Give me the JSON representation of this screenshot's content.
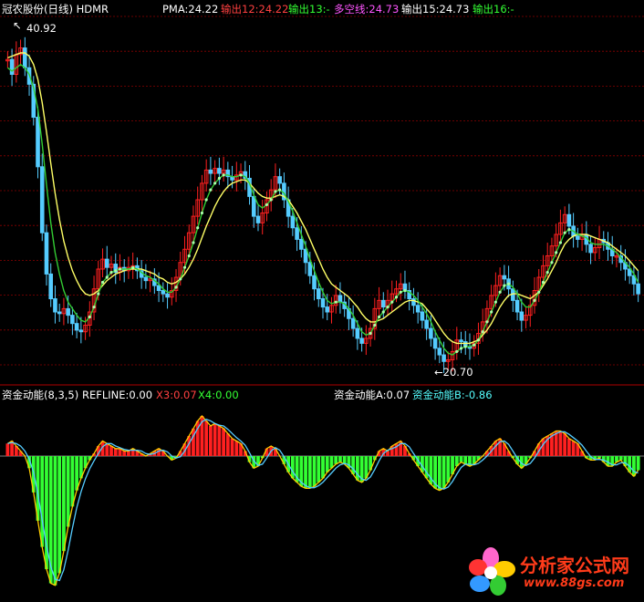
{
  "header": {
    "title": "冠农股份(日线) HDMR",
    "pma": "PMA:24.22",
    "out12": "输出12:24.22",
    "out13": "输出13:-",
    "multi": "多空线:24.73",
    "out15": "输出15:24.73",
    "out16": "输出16:-"
  },
  "indicator": {
    "title": "资金动能(8,3,5)",
    "refline": "REFLINE:0.00",
    "x3": "X3:0.07",
    "x4": "X4:0.00",
    "a": "资金动能A:0.07",
    "b": "资金动能B:-0.86"
  },
  "annotations": {
    "high": "40.92",
    "low": "←20.70",
    "high_arrow": "↖"
  },
  "watermark": {
    "text": "分析家公式网",
    "url": "www.88gs.com"
  },
  "colors": {
    "background": "#000000",
    "grid": "#8b0000",
    "up_candle": "#ff2020",
    "down_candle": "#55ccff",
    "yellow_line": "#ffff66",
    "green_line": "#33cc33",
    "dot_line": "#aaffaa",
    "hist_pos": "#ff2020",
    "hist_neg": "#33ff33",
    "ind_a": "#ffcc00",
    "ind_b": "#55ccff",
    "text_white": "#ffffff",
    "text_red": "#ff4040",
    "text_green": "#33ff33",
    "text_magenta": "#ff55ff",
    "text_cyan": "#55ffff"
  },
  "chart_data": [
    {
      "type": "candlestick",
      "title": "冠农股份(日线) HDMR",
      "ylim": [
        20.0,
        42.0
      ],
      "annotations": [
        {
          "label": "40.92",
          "kind": "high"
        },
        {
          "label": "20.70",
          "kind": "low"
        }
      ],
      "close": [
        39.5,
        38.6,
        39.8,
        40.2,
        39.0,
        38.0,
        36.0,
        33.0,
        29.0,
        26.5,
        25.0,
        24.2,
        24.1,
        24.4,
        24.0,
        23.5,
        23.1,
        23.0,
        23.4,
        24.2,
        25.6,
        26.8,
        27.4,
        26.9,
        27.1,
        26.6,
        26.9,
        26.7,
        26.9,
        27.0,
        26.7,
        26.3,
        26.1,
        26.2,
        25.8,
        25.5,
        25.3,
        25.1,
        25.5,
        26.3,
        27.2,
        28.0,
        29.0,
        30.0,
        31.0,
        32.0,
        32.8,
        32.6,
        32.9,
        32.6,
        32.8,
        32.4,
        32.2,
        32.5,
        32.7,
        32.3,
        31.2,
        30.0,
        29.6,
        30.2,
        31.0,
        31.6,
        32.4,
        32.0,
        31.0,
        30.0,
        29.3,
        28.6,
        28.0,
        27.2,
        26.4,
        25.6,
        25.0,
        24.5,
        24.2,
        24.6,
        25.2,
        24.8,
        24.4,
        23.8,
        23.2,
        22.6,
        22.3,
        22.6,
        23.2,
        24.4,
        24.9,
        24.5,
        24.9,
        25.3,
        25.6,
        25.9,
        25.5,
        25.0,
        24.6,
        24.2,
        23.7,
        23.2,
        22.6,
        22.0,
        21.6,
        21.2,
        21.3,
        21.8,
        22.5,
        22.4,
        22.1,
        22.0,
        22.3,
        22.9,
        23.6,
        24.4,
        25.2,
        25.8,
        26.4,
        26.2,
        25.6,
        24.9,
        24.2,
        23.7,
        24.0,
        24.6,
        25.5,
        26.3,
        27.0,
        27.6,
        28.2,
        28.9,
        29.6,
        30.1,
        29.4,
        28.8,
        28.6,
        28.9,
        28.3,
        27.8,
        28.1,
        28.6,
        28.4,
        28.0,
        27.6,
        27.6,
        27.2,
        26.8,
        26.4,
        25.9,
        25.3
      ],
      "series": [
        {
          "name": "输出12",
          "values": [
            39.0,
            38.8,
            39.0,
            39.2,
            39.0,
            38.6,
            37.8,
            36.5,
            34.4,
            31.9,
            29.6,
            27.8,
            26.5,
            25.5,
            24.8,
            24.4,
            24.0,
            23.7,
            23.6,
            23.9,
            24.5,
            25.3,
            26.0,
            26.3,
            26.6,
            26.7,
            26.8,
            26.8,
            26.8,
            26.9,
            26.8,
            26.6,
            26.4,
            26.3,
            26.1,
            25.9,
            25.6,
            25.4,
            25.4,
            25.7,
            26.2,
            26.9,
            27.6,
            28.4,
            29.3,
            30.2,
            31.0,
            31.6,
            32.0,
            32.3,
            32.5,
            32.5,
            32.4,
            32.4,
            32.5,
            32.4,
            32.0,
            31.3,
            30.7,
            30.5,
            30.7,
            31.0,
            31.5,
            31.6,
            31.4,
            30.9,
            30.3,
            29.6,
            28.9,
            28.2,
            27.4,
            26.7,
            26.0,
            25.4,
            24.9,
            24.7,
            24.8,
            24.8,
            24.7,
            24.4,
            24.0,
            23.5,
            23.0,
            22.8,
            22.9,
            23.4,
            23.9,
            24.2,
            24.5,
            24.8,
            25.1,
            25.4,
            25.5,
            25.4,
            25.2,
            24.9,
            24.5,
            24.1,
            23.6,
            23.0,
            22.5,
            22.0,
            21.7,
            21.6,
            21.8,
            22.0,
            22.1,
            22.1,
            22.2,
            22.5,
            23.0,
            23.6,
            24.2,
            24.8,
            25.4,
            25.8,
            25.9,
            25.7,
            25.3,
            24.8,
            24.5,
            24.5,
            24.9,
            25.4,
            26.0,
            26.6,
            27.2,
            27.8,
            28.4,
            29.0,
            29.2,
            29.1,
            28.9,
            28.8,
            28.7,
            28.4,
            28.3,
            28.3,
            28.3,
            28.2,
            28.0,
            27.8,
            27.5,
            27.2,
            26.9,
            26.5,
            26.0
          ]
        },
        {
          "name": "多空线",
          "values": [
            39.6,
            39.7,
            39.8,
            39.9,
            39.9,
            39.7,
            39.2,
            38.3,
            36.9,
            35.1,
            33.2,
            31.4,
            29.8,
            28.5,
            27.5,
            26.7,
            26.1,
            25.6,
            25.3,
            25.2,
            25.3,
            25.5,
            25.8,
            26.1,
            26.3,
            26.5,
            26.6,
            26.7,
            26.8,
            26.8,
            26.8,
            26.8,
            26.7,
            26.6,
            26.5,
            26.3,
            26.2,
            26.0,
            25.9,
            26.0,
            26.2,
            26.5,
            26.9,
            27.4,
            28.0,
            28.7,
            29.4,
            30.0,
            30.6,
            31.1,
            31.5,
            31.8,
            32.0,
            32.1,
            32.2,
            32.2,
            32.0,
            31.7,
            31.4,
            31.2,
            31.1,
            31.1,
            31.2,
            31.3,
            31.2,
            31.0,
            30.6,
            30.2,
            29.7,
            29.2,
            28.6,
            28.0,
            27.4,
            26.8,
            26.3,
            25.9,
            25.7,
            25.5,
            25.3,
            25.1,
            24.8,
            24.5,
            24.1,
            23.8,
            23.6,
            23.6,
            23.7,
            23.8,
            24.0,
            24.2,
            24.4,
            24.6,
            24.8,
            24.9,
            24.9,
            24.8,
            24.7,
            24.4,
            24.1,
            23.7,
            23.3,
            22.9,
            22.6,
            22.4,
            22.3,
            22.3,
            22.3,
            22.3,
            22.4,
            22.5,
            22.8,
            23.1,
            23.5,
            24.0,
            24.5,
            24.9,
            25.2,
            25.3,
            25.3,
            25.2,
            25.1,
            25.0,
            25.2,
            25.4,
            25.8,
            26.2,
            26.7,
            27.2,
            27.8,
            28.3,
            28.6,
            28.8,
            28.9,
            28.9,
            28.9,
            28.8,
            28.7,
            28.6,
            28.5,
            28.4,
            28.2,
            28.0,
            27.8,
            27.6,
            27.3,
            27.0,
            26.7
          ]
        }
      ],
      "legend": [
        "PMA:24.22",
        "输出12:24.22",
        "输出13:-",
        "多空线:24.73",
        "输出15:24.73",
        "输出16:-"
      ]
    },
    {
      "type": "bar",
      "title": "资金动能(8,3,5)",
      "ylim": [
        -0.7,
        0.2
      ],
      "values": [
        0.05,
        0.06,
        0.04,
        0.02,
        0.0,
        -0.06,
        -0.18,
        -0.32,
        -0.45,
        -0.56,
        -0.63,
        -0.64,
        -0.58,
        -0.47,
        -0.35,
        -0.25,
        -0.17,
        -0.11,
        -0.06,
        -0.02,
        0.01,
        0.04,
        0.06,
        0.05,
        0.04,
        0.03,
        0.03,
        0.02,
        0.02,
        0.03,
        0.02,
        0.01,
        0.0,
        0.01,
        0.02,
        0.03,
        0.02,
        0.0,
        -0.02,
        -0.01,
        0.02,
        0.05,
        0.08,
        0.11,
        0.14,
        0.16,
        0.14,
        0.12,
        0.13,
        0.12,
        0.11,
        0.09,
        0.07,
        0.06,
        0.05,
        0.02,
        -0.03,
        -0.06,
        -0.05,
        -0.01,
        0.03,
        0.04,
        0.03,
        0.0,
        -0.04,
        -0.08,
        -0.11,
        -0.13,
        -0.15,
        -0.16,
        -0.16,
        -0.15,
        -0.13,
        -0.11,
        -0.08,
        -0.06,
        -0.04,
        -0.03,
        -0.04,
        -0.06,
        -0.09,
        -0.12,
        -0.13,
        -0.11,
        -0.07,
        -0.02,
        0.02,
        0.03,
        0.02,
        0.04,
        0.05,
        0.06,
        0.04,
        0.01,
        -0.02,
        -0.05,
        -0.08,
        -0.11,
        -0.14,
        -0.16,
        -0.17,
        -0.16,
        -0.13,
        -0.09,
        -0.05,
        -0.03,
        -0.04,
        -0.05,
        -0.04,
        -0.02,
        0.0,
        0.02,
        0.04,
        0.06,
        0.07,
        0.05,
        0.02,
        -0.01,
        -0.04,
        -0.06,
        -0.04,
        -0.01,
        0.02,
        0.05,
        0.07,
        0.08,
        0.09,
        0.1,
        0.1,
        0.09,
        0.07,
        0.06,
        0.05,
        0.02,
        -0.01,
        -0.02,
        -0.02,
        -0.01,
        -0.03,
        -0.05,
        -0.05,
        -0.03,
        -0.02,
        -0.05,
        -0.08,
        -0.1,
        -0.07
      ]
    }
  ]
}
